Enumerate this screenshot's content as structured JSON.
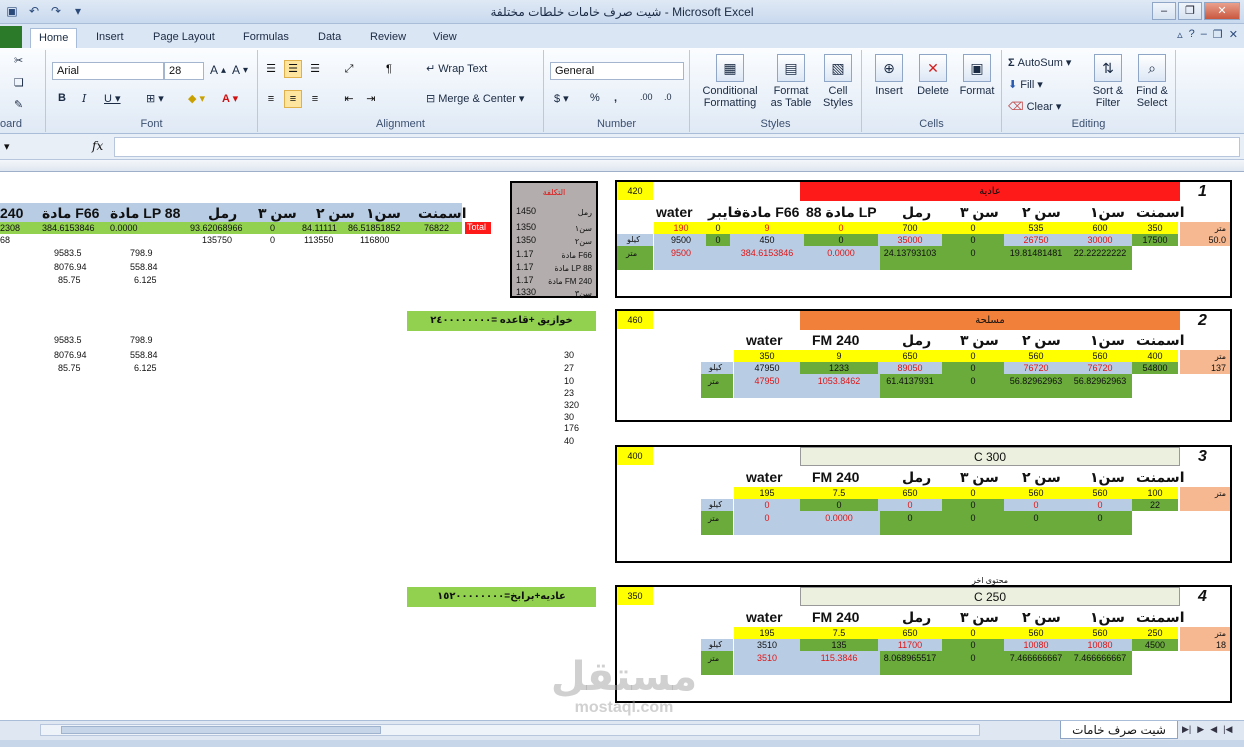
{
  "window": {
    "title": "شيت صرف خامات خلطات مختلفة  -  Microsoft Excel",
    "controls": [
      "–",
      "❐",
      "✕"
    ]
  },
  "ribbon": {
    "tabs": [
      "Home",
      "Insert",
      "Page Layout",
      "Formulas",
      "Data",
      "Review",
      "View"
    ],
    "groups": {
      "clipboard": "oard",
      "font": "Font",
      "alignment": "Alignment",
      "number": "Number",
      "styles": "Styles",
      "cells": "Cells",
      "editing": "Editing"
    },
    "font_name": "Arial",
    "font_size": "28",
    "wrap_text": "Wrap Text",
    "merge_center": "Merge & Center",
    "number_format": "General",
    "conditional_formatting": "Conditional\nFormatting",
    "format_as_table": "Format\nas Table",
    "cell_styles": "Cell\nStyles",
    "insert": "Insert",
    "delete": "Delete",
    "format": "Format",
    "autosum": "AutoSum",
    "fill": "Fill",
    "clear": "Clear",
    "sort_filter": "Sort &\nFilter",
    "find_select": "Find &\nSelect"
  },
  "formula_bar": {
    "fx": "fx"
  },
  "sheet": {
    "left": {
      "headers": [
        "240",
        "مادة F66",
        "مادة LP 88",
        "رمل",
        "سن ٣",
        "سن ٢",
        "سن١",
        "اسمنت"
      ],
      "row1": [
        "2308",
        "384.6153846",
        "0.0000",
        "93.62068966",
        "0",
        "84.11111",
        "86.51851852",
        "76822"
      ],
      "total_label": "Total",
      "row2": [
        "68",
        "135750",
        "0",
        "113550",
        "116800"
      ],
      "calc1": [
        [
          "9583.5",
          "798.9"
        ],
        [
          "8076.94",
          "558.84"
        ],
        [
          "85.75",
          "6.125"
        ]
      ],
      "calc2": [
        [
          "9583.5",
          "798.9"
        ],
        [
          "8076.94",
          "558.84"
        ],
        [
          "85.75",
          "6.125"
        ]
      ],
      "note1": "خوازيق +قاعده =٢٤٠٠٠٠٠٠٠٠",
      "note2": "عاديه+برابخ=١٥٢٠٠٠٠٠٠٠٠",
      "numlist": [
        "30",
        "27",
        "10",
        "23",
        "320",
        "30",
        "176",
        "40"
      ],
      "cost_title": "التكلفة",
      "cost_rows": [
        [
          "1450",
          "رمل"
        ],
        [
          "1350",
          "سن١"
        ],
        [
          "1350",
          "سن٢"
        ],
        [
          "1.17",
          "مادة F66"
        ],
        [
          "1.17",
          "مادة LP 88"
        ],
        [
          "1.17",
          "مادة FM 240"
        ],
        [
          "1330",
          "سن٣"
        ]
      ]
    },
    "blocks": [
      {
        "num": "1",
        "code": "420",
        "name": "عادية",
        "headers": [
          "water",
          "فايبر",
          "مادة F66",
          "مادة 88 LP",
          "رمل",
          "سن ٣",
          "سن ٢",
          "سن١",
          "اسمنت"
        ],
        "unit_m": "متر",
        "unit_kg": "كيلو",
        "yellow": [
          "190",
          "0",
          "9",
          "0",
          "700",
          "0",
          "535",
          "600",
          "350"
        ],
        "kg": [
          "9500",
          "0",
          "450",
          "0",
          "35000",
          "0",
          "26750",
          "30000",
          "17500"
        ],
        "qty": "50.0",
        "m": [
          "9500",
          "384.6153846",
          "0.0000",
          "24.13793103",
          "0",
          "19.81481481",
          "22.22222222"
        ]
      },
      {
        "num": "2",
        "code": "460",
        "name": "مسلحة",
        "headers": [
          "water",
          "FM 240",
          "رمل",
          "سن ٣",
          "سن ٢",
          "سن١",
          "اسمنت"
        ],
        "unit_m": "متر",
        "unit_kg": "كيلو",
        "yellow": [
          "350",
          "9",
          "650",
          "0",
          "560",
          "560",
          "400"
        ],
        "kg": [
          "47950",
          "1233",
          "89050",
          "0",
          "76720",
          "76720",
          "54800"
        ],
        "qty": "137",
        "m": [
          "47950",
          "1053.8462",
          "61.4137931",
          "0",
          "56.82962963",
          "56.82962963"
        ]
      },
      {
        "num": "3",
        "code": "400",
        "name": "C 300",
        "headers": [
          "water",
          "FM 240",
          "رمل",
          "سن ٣",
          "سن ٢",
          "سن١",
          "اسمنت"
        ],
        "unit_m": "متر",
        "unit_kg": "كيلو",
        "yellow": [
          "195",
          "7.5",
          "650",
          "0",
          "560",
          "560",
          "100"
        ],
        "kg": [
          "0",
          "0",
          "0",
          "0",
          "0",
          "0",
          "22"
        ],
        "qty": "",
        "m": [
          "0",
          "0.0000",
          "0",
          "0",
          "0",
          "0"
        ]
      },
      {
        "num": "4",
        "code": "350",
        "name": "C 250",
        "extra": "محتوى اخر",
        "headers": [
          "water",
          "FM 240",
          "رمل",
          "سن ٣",
          "سن ٢",
          "سن١",
          "اسمنت"
        ],
        "unit_m": "متر",
        "unit_kg": "كيلو",
        "yellow": [
          "195",
          "7.5",
          "650",
          "0",
          "560",
          "560",
          "250"
        ],
        "kg": [
          "3510",
          "135",
          "11700",
          "0",
          "10080",
          "10080",
          "4500"
        ],
        "qty": "18",
        "m": [
          "3510",
          "115.3846",
          "8.068965517",
          "0",
          "7.466666667",
          "7.466666667"
        ]
      }
    ]
  },
  "bottom": {
    "sheet_tab": "شيت صرف خامات",
    "watermark_ar": "مستقل",
    "watermark_en": "mostaql.com"
  }
}
